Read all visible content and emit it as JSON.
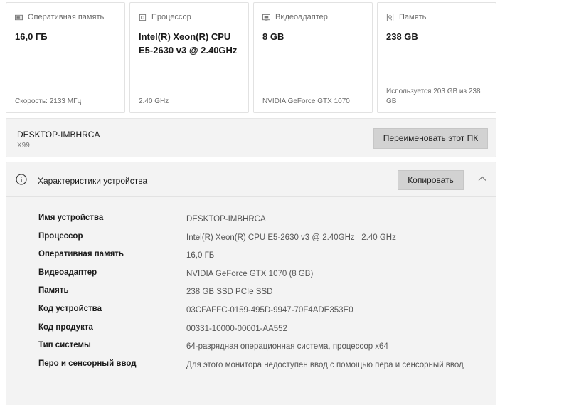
{
  "cards": [
    {
      "icon": "ram-icon",
      "title": "Оперативная память",
      "value": "16,0 ГБ",
      "footer": "Скорость: 2133 МГц"
    },
    {
      "icon": "processor-icon",
      "title": "Процессор",
      "value": "Intel(R) Xeon(R) CPU E5-2630 v3 @ 2.40GHz",
      "footer": "2.40 GHz"
    },
    {
      "icon": "gpu-icon",
      "title": "Видеоадаптер",
      "value": "8 GB",
      "footer": "NVIDIA GeForce GTX 1070"
    },
    {
      "icon": "storage-icon",
      "title": "Память",
      "value": "238 GB",
      "footer": "Используется 203 GB из 238 GB"
    }
  ],
  "pc": {
    "name": "DESKTOP-IMBHRCA",
    "model": "X99",
    "rename_label": "Переименовать этот ПК"
  },
  "specs": {
    "title": "Характеристики устройства",
    "copy_label": "Копировать",
    "rows": [
      {
        "label": "Имя устройства",
        "value": "DESKTOP-IMBHRCA"
      },
      {
        "label": "Процессор",
        "value": "Intel(R) Xeon(R) CPU E5-2630 v3 @ 2.40GHz   2.40 GHz"
      },
      {
        "label": "Оперативная память",
        "value": "16,0 ГБ"
      },
      {
        "label": "Видеоадаптер",
        "value": "NVIDIA GeForce GTX 1070 (8 GB)"
      },
      {
        "label": "Память",
        "value": "238 GB SSD PCIe SSD"
      },
      {
        "label": "Код устройства",
        "value": "03CFAFFC-0159-495D-9947-70F4ADE353E0"
      },
      {
        "label": "Код продукта",
        "value": "00331-10000-00001-AA552"
      },
      {
        "label": "Тип системы",
        "value": "64-разрядная операционная система, процессор x64"
      },
      {
        "label": "Перо и сенсорный ввод",
        "value": "Для этого монитора недоступен ввод с помощью пера и сенсорный ввод"
      }
    ]
  }
}
